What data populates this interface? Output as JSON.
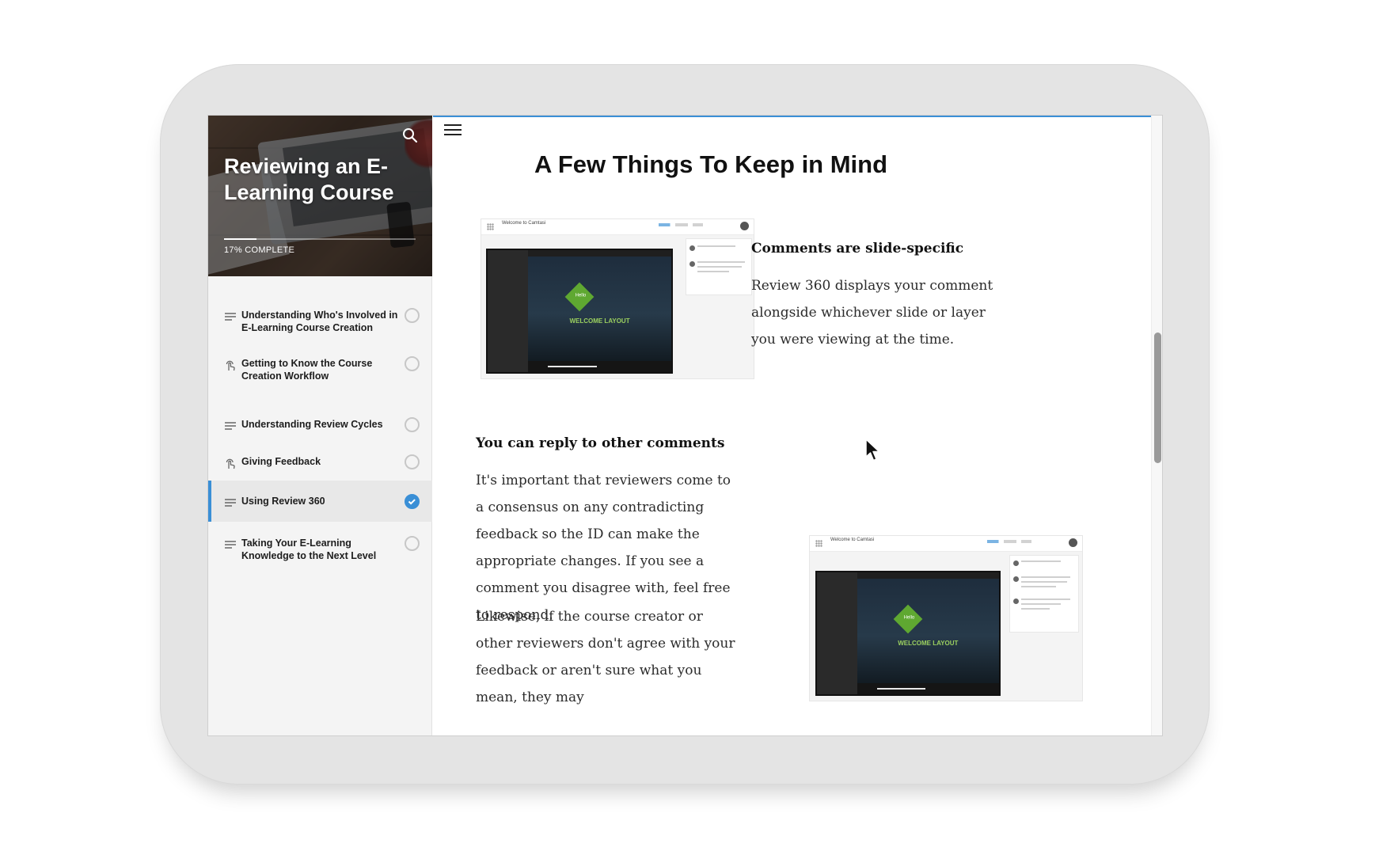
{
  "course": {
    "title": "Reviewing an E-Learning Course",
    "progress_label": "17% COMPLETE",
    "progress_fraction": 0.17
  },
  "lessons": [
    {
      "label": "Understanding Who's Involved in E-Learning Course Creation",
      "icon": "lines-icon",
      "status": "incomplete"
    },
    {
      "label": "Getting to Know the Course Creation Workflow",
      "icon": "touch-icon",
      "status": "incomplete"
    },
    {
      "label": "Understanding Review Cycles",
      "icon": "lines-icon",
      "status": "incomplete"
    },
    {
      "label": "Giving Feedback",
      "icon": "touch-icon",
      "status": "incomplete"
    },
    {
      "label": "Using Review 360",
      "icon": "lines-icon",
      "status": "complete",
      "active": true
    },
    {
      "label": "Taking Your E-Learning Knowledge to the Next Level",
      "icon": "lines-icon",
      "status": "incomplete"
    }
  ],
  "main": {
    "page_title": "A Few Things To Keep in Mind",
    "section1": {
      "heading": "Comments are slide-specific",
      "body": "Review 360 displays your comment alongside whichever slide or layer you were viewing at the time."
    },
    "section2": {
      "heading": "You can reply to other comments",
      "body1": "It's important that reviewers come to a consensus on any contradicting feedback so the ID can make the appropriate changes. If you see a comment you disagree with, feel free to respond.",
      "body2": "Likewise, if the course creator or other reviewers don't agree with your feedback or aren't sure what you mean, they may"
    },
    "shot": {
      "app_title": "Welcome to Camtasi",
      "player_title": "Welcome to Camtasi",
      "badge": "Hello",
      "slide_title": "WELCOME LAYOUT"
    }
  },
  "colors": {
    "accent": "#3a8fd6",
    "tablet_frame": "#e4e4e4",
    "sidebar_bg": "#f4f4f4"
  }
}
